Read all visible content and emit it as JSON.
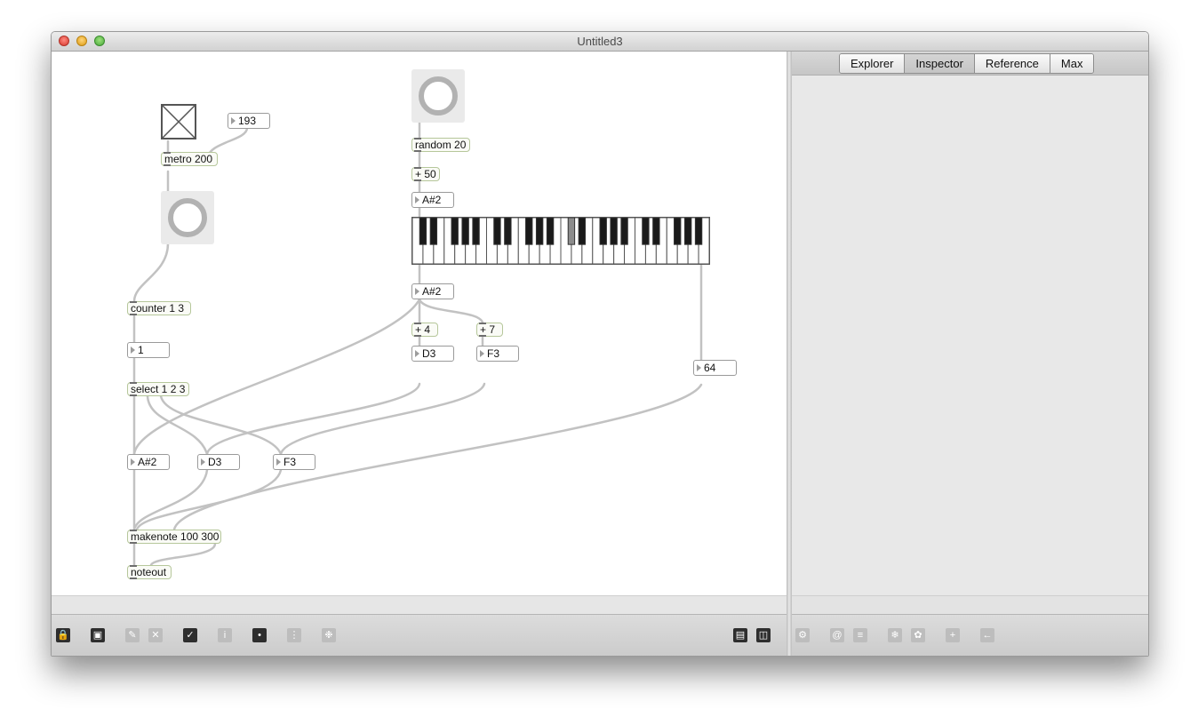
{
  "window": {
    "title": "Untitled3"
  },
  "sidebar": {
    "tabs": [
      {
        "label": "Explorer",
        "active": false
      },
      {
        "label": "Inspector",
        "active": true
      },
      {
        "label": "Reference",
        "active": false
      },
      {
        "label": "Max",
        "active": false
      }
    ]
  },
  "patcher": {
    "objects": {
      "metro": "metro 200",
      "counter": "counter 1 3",
      "select": "select 1 2 3",
      "random": "random 20",
      "plus50": "+ 50",
      "plus4": "+ 4",
      "plus7": "+ 7",
      "makenote": "makenote 100 300",
      "noteout": "noteout"
    },
    "numbers": {
      "interval": "193",
      "count": "1",
      "note_top": "A#2",
      "note_kbd": "A#2",
      "third": "D3",
      "fifth": "F3",
      "out1": "A#2",
      "out2": "D3",
      "out3": "F3",
      "velocity": "64"
    },
    "keyboard": {
      "highlighted_key": "A#2",
      "highlight_color": "#8c8c8c"
    }
  },
  "toolbar_left": {
    "icons": [
      "lock-icon",
      "presentation-icon",
      "edit-wand-icon",
      "clear-icon",
      "debug-icon",
      "info-icon",
      "slider-icon",
      "grid-icon",
      "snap-icon",
      "split-horizontal-icon",
      "split-vertical-icon"
    ]
  },
  "toolbar_right": {
    "icons": [
      "gear-icon",
      "at-icon",
      "list-icon",
      "snowflake-icon",
      "flower-icon",
      "plus-icon",
      "back-arrow-icon"
    ]
  }
}
